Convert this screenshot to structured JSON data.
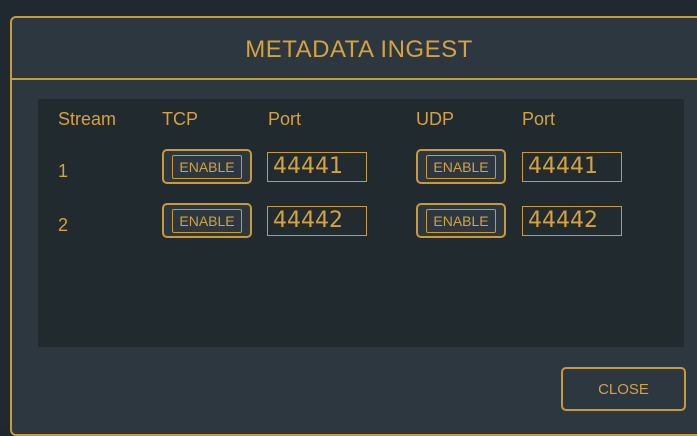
{
  "dialog": {
    "title": "METADATA INGEST",
    "close_label": "CLOSE"
  },
  "table": {
    "headers": {
      "stream": "Stream",
      "tcp": "TCP",
      "tcp_port": "Port",
      "udp": "UDP",
      "udp_port": "Port"
    },
    "rows": [
      {
        "stream": "1",
        "tcp_button": "ENABLE",
        "tcp_port": "44441",
        "udp_button": "ENABLE",
        "udp_port": "44441"
      },
      {
        "stream": "2",
        "tcp_button": "ENABLE",
        "tcp_port": "44442",
        "udp_button": "ENABLE",
        "udp_port": "44442"
      }
    ]
  },
  "colors": {
    "accent": "#c89a3a",
    "text": "#d4a23f",
    "dialog_bg": "#2c373f",
    "panel_bg": "#212a2f"
  }
}
